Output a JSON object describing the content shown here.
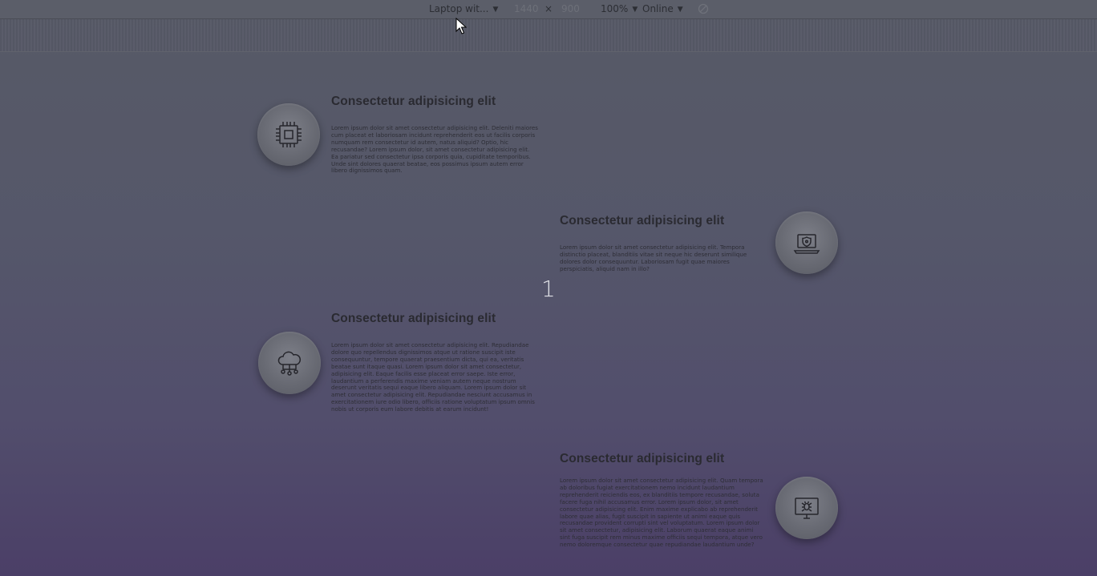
{
  "toolbar": {
    "device": "Laptop wit...",
    "width": "1440",
    "times": "×",
    "height": "900",
    "zoom": "100%",
    "network": "Online"
  },
  "page_number": "1",
  "features": [
    {
      "title": "Consectetur adipisicing elit",
      "icon": "cpu-chip-icon",
      "body": "Lorem ipsum dolor sit amet consectetur adipisicing elit. Deleniti maiores cum placeat et laboriosam incidunt reprehenderit eos ut facilis corporis numquam rem consectetur id autem, natus aliquid? Optio, hic recusandae? Lorem ipsum dolor, sit amet consectetur adipisicing elit. Ea pariatur sed consectetur ipsa corporis quia, cupiditate temporibus. Unde sint dolores quaerat beatae, eos possimus ipsum autem error libero dignissimos quam."
    },
    {
      "title": "Consectetur adipisicing elit",
      "icon": "laptop-security-icon",
      "body": "Lorem ipsum dolor sit amet consectetur adipisicing elit. Tempora distinctio placeat, blanditiis vitae sit neque hic deserunt similique dolores dolor consequuntur. Laboriosam fugit quae maiores perspiciatis, aliquid nam in illo?"
    },
    {
      "title": "Consectetur adipisicing elit",
      "icon": "cloud-network-icon",
      "body": "Lorem ipsum dolor sit amet consectetur adipisicing elit. Repudiandae dolore quo repellendus dignissimos atque ut ratione suscipit iste consequuntur, tempore quaerat praesentium dicta, qui ea, veritatis beatae sunt itaque quasi. Lorem ipsum dolor sit amet consectetur, adipisicing elit. Eaque facilis esse placeat error saepe. Iste error, laudantium a perferendis maxime veniam autem neque nostrum deserunt veritatis sequi eaque libero aliquam. Lorem ipsum dolor sit amet consectetur adipisicing elit. Repudiandae nesciunt accusamus in exercitationem iure odio libero, officiis ratione voluptatum ipsum omnis nobis ut corporis eum labore debitis at earum incidunt!"
    },
    {
      "title": "Consectetur adipisicing elit",
      "icon": "monitor-bug-icon",
      "body": "Lorem ipsum dolor sit amet consectetur adipisicing elit. Quam tempora ab doloribus fugiat exercitationem nemo incidunt laudantium reprehenderit reiciendis eos, ex blanditiis tempore recusandae, soluta facere fuga nihil accusamus error. Lorem ipsum dolor, sit amet consectetur adipisicing elit. Enim maxime explicabo ab reprehenderit labore quae alias, fugit suscipit in sapiente ut animi eaque quis recusandae provident corrupti sint vel voluptatum. Lorem ipsum dolor sit amet consectetur, adipisicing elit. Laborum quaerat eaque animi sint fuga suscipit rem minus maxime officiis sequi tempora, atque vero nemo doloremque consectetur quae repudiandae laudantium unde?"
    }
  ]
}
